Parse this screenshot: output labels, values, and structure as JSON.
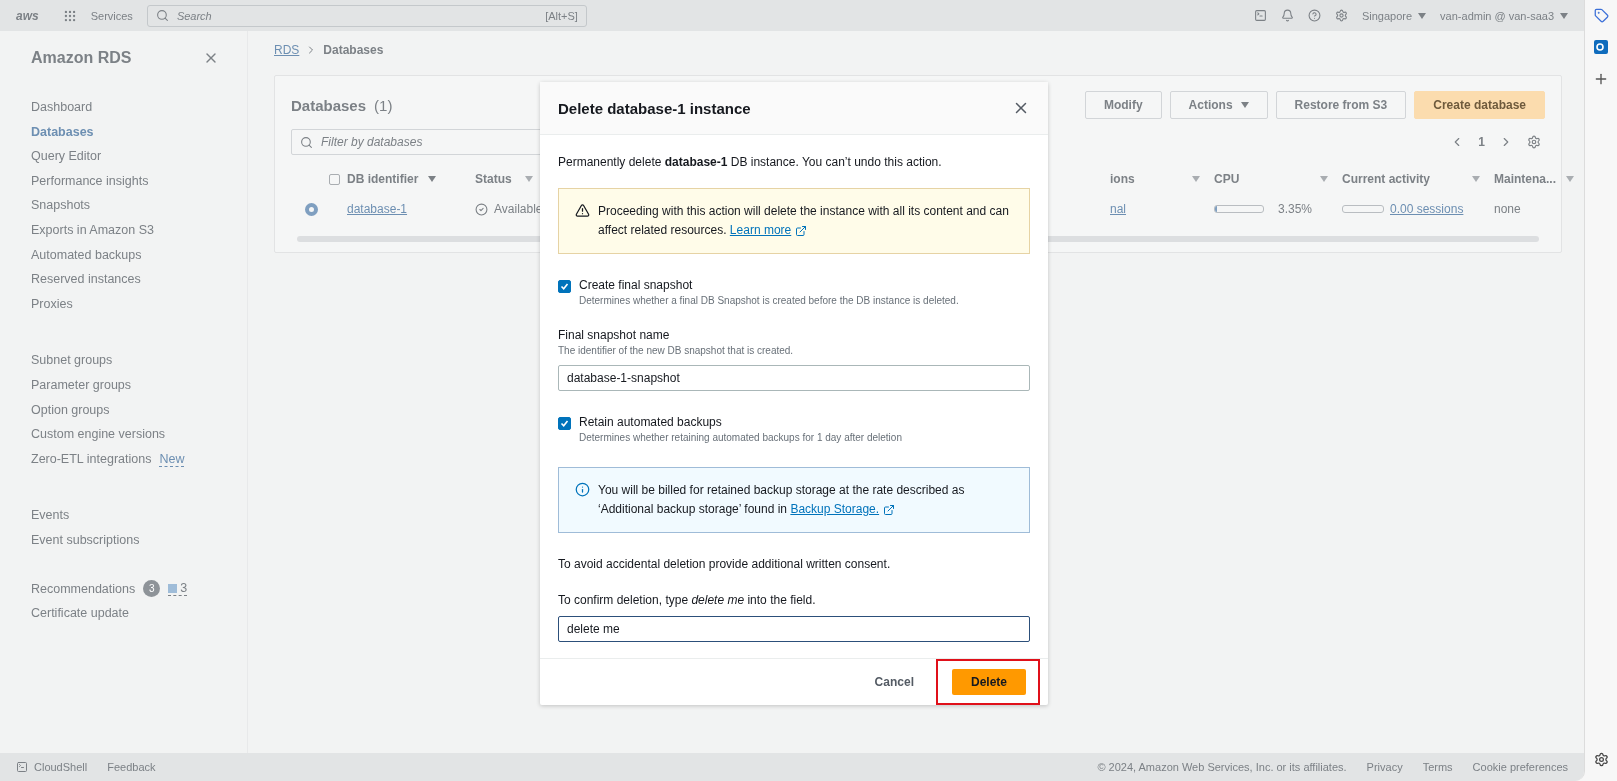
{
  "top_bar": {
    "logo": "aws",
    "services": "Services",
    "search": {
      "placeholder": "Search",
      "shortcut": "[Alt+S]"
    },
    "region": "Singapore",
    "account": "van-admin @ van-saa3"
  },
  "sidebar": {
    "title": "Amazon RDS",
    "sections": [
      {
        "items": [
          {
            "label": "Dashboard",
            "selected": false
          },
          {
            "label": "Databases",
            "selected": true
          },
          {
            "label": "Query Editor",
            "selected": false
          },
          {
            "label": "Performance insights",
            "selected": false
          },
          {
            "label": "Snapshots",
            "selected": false
          },
          {
            "label": "Exports in Amazon S3",
            "selected": false
          },
          {
            "label": "Automated backups",
            "selected": false
          },
          {
            "label": "Reserved instances",
            "selected": false
          },
          {
            "label": "Proxies",
            "selected": false
          }
        ]
      },
      {
        "items": [
          {
            "label": "Subnet groups",
            "selected": false
          },
          {
            "label": "Parameter groups",
            "selected": false
          },
          {
            "label": "Option groups",
            "selected": false
          },
          {
            "label": "Custom engine versions",
            "selected": false
          },
          {
            "label": "Zero-ETL integrations",
            "selected": false,
            "badge": "New"
          }
        ]
      },
      {
        "items": [
          {
            "label": "Events",
            "selected": false
          },
          {
            "label": "Event subscriptions",
            "selected": false
          }
        ]
      }
    ],
    "recommendations": {
      "label": "Recommendations",
      "count": "3",
      "info_count": "3"
    },
    "extra_items": [
      {
        "label": "Certificate update",
        "selected": false
      }
    ]
  },
  "breadcrumbs": [
    {
      "label": "RDS",
      "link": true
    },
    {
      "label": "Databases",
      "link": false
    }
  ],
  "databases": {
    "title": "Databases",
    "count": "(1)",
    "select_all_checked": false,
    "filter_placeholder": "Filter by databases",
    "page": "1",
    "buttons": [
      {
        "label": "Modify",
        "kind": "normal"
      },
      {
        "label": "Actions",
        "kind": "dropdown"
      },
      {
        "label": "Restore from S3",
        "kind": "normal"
      },
      {
        "label": "Create database",
        "kind": "primary"
      }
    ],
    "columns": [
      {
        "label": "DB identifier",
        "sorted": true,
        "filter": false
      },
      {
        "label": "Status",
        "sorted": false,
        "filter": true
      },
      {
        "label": "ions",
        "sorted": false,
        "filter": true
      },
      {
        "label": "CPU",
        "sorted": false,
        "filter": true
      },
      {
        "label": "Current activity",
        "sorted": false,
        "filter": true
      },
      {
        "label": "Maintena...",
        "sorted": false,
        "filter": true
      }
    ],
    "rows": [
      {
        "selected": true,
        "db_identifier": "database-1",
        "status": "Available",
        "column_3": "nal",
        "cpu": {
          "level": 0.0335,
          "reading": "3.35%"
        },
        "activity": {
          "level": 0,
          "reading": "0.00 sessions"
        },
        "maintenance": "none"
      }
    ]
  },
  "dialog": {
    "title": "Delete database-1 instance",
    "intro": "Permanently delete **database-1** DB instance. You can’t undo this action.",
    "warning": {
      "text": "Proceeding with this action will delete the instance with all its content and can affect related resources.",
      "link": "Learn more"
    },
    "final_snapshot": {
      "label": "Create final snapshot",
      "description": "Determines whether a final DB Snapshot is created before the DB instance is deleted.",
      "checked": true
    },
    "snapshot_name": {
      "label": "Final snapshot name",
      "description": "The identifier of the new DB snapshot that is created.",
      "value": "database-1-snapshot"
    },
    "retain_backups": {
      "label": "Retain automated backups",
      "description": "Determines whether retaining automated backups for 1 day after deletion",
      "checked": true
    },
    "info": {
      "text": "You will be billed for retained backup storage at the rate described as ‘Additional backup storage’ found in",
      "link": "Backup Storage."
    },
    "consent": "To avoid accidental deletion provide additional written consent.",
    "confirm": {
      "label": "To confirm deletion, type *delete me* into the field.",
      "value": "delete me"
    },
    "cancel": "Cancel",
    "delete": "Delete",
    "delete_highlighted": true
  },
  "footer": {
    "cloudshell": "CloudShell",
    "feedback": "Feedback",
    "copyright": "© 2024, Amazon Web Services, Inc. or its affiliates.",
    "links": [
      "Privacy",
      "Terms",
      "Cookie preferences"
    ]
  }
}
